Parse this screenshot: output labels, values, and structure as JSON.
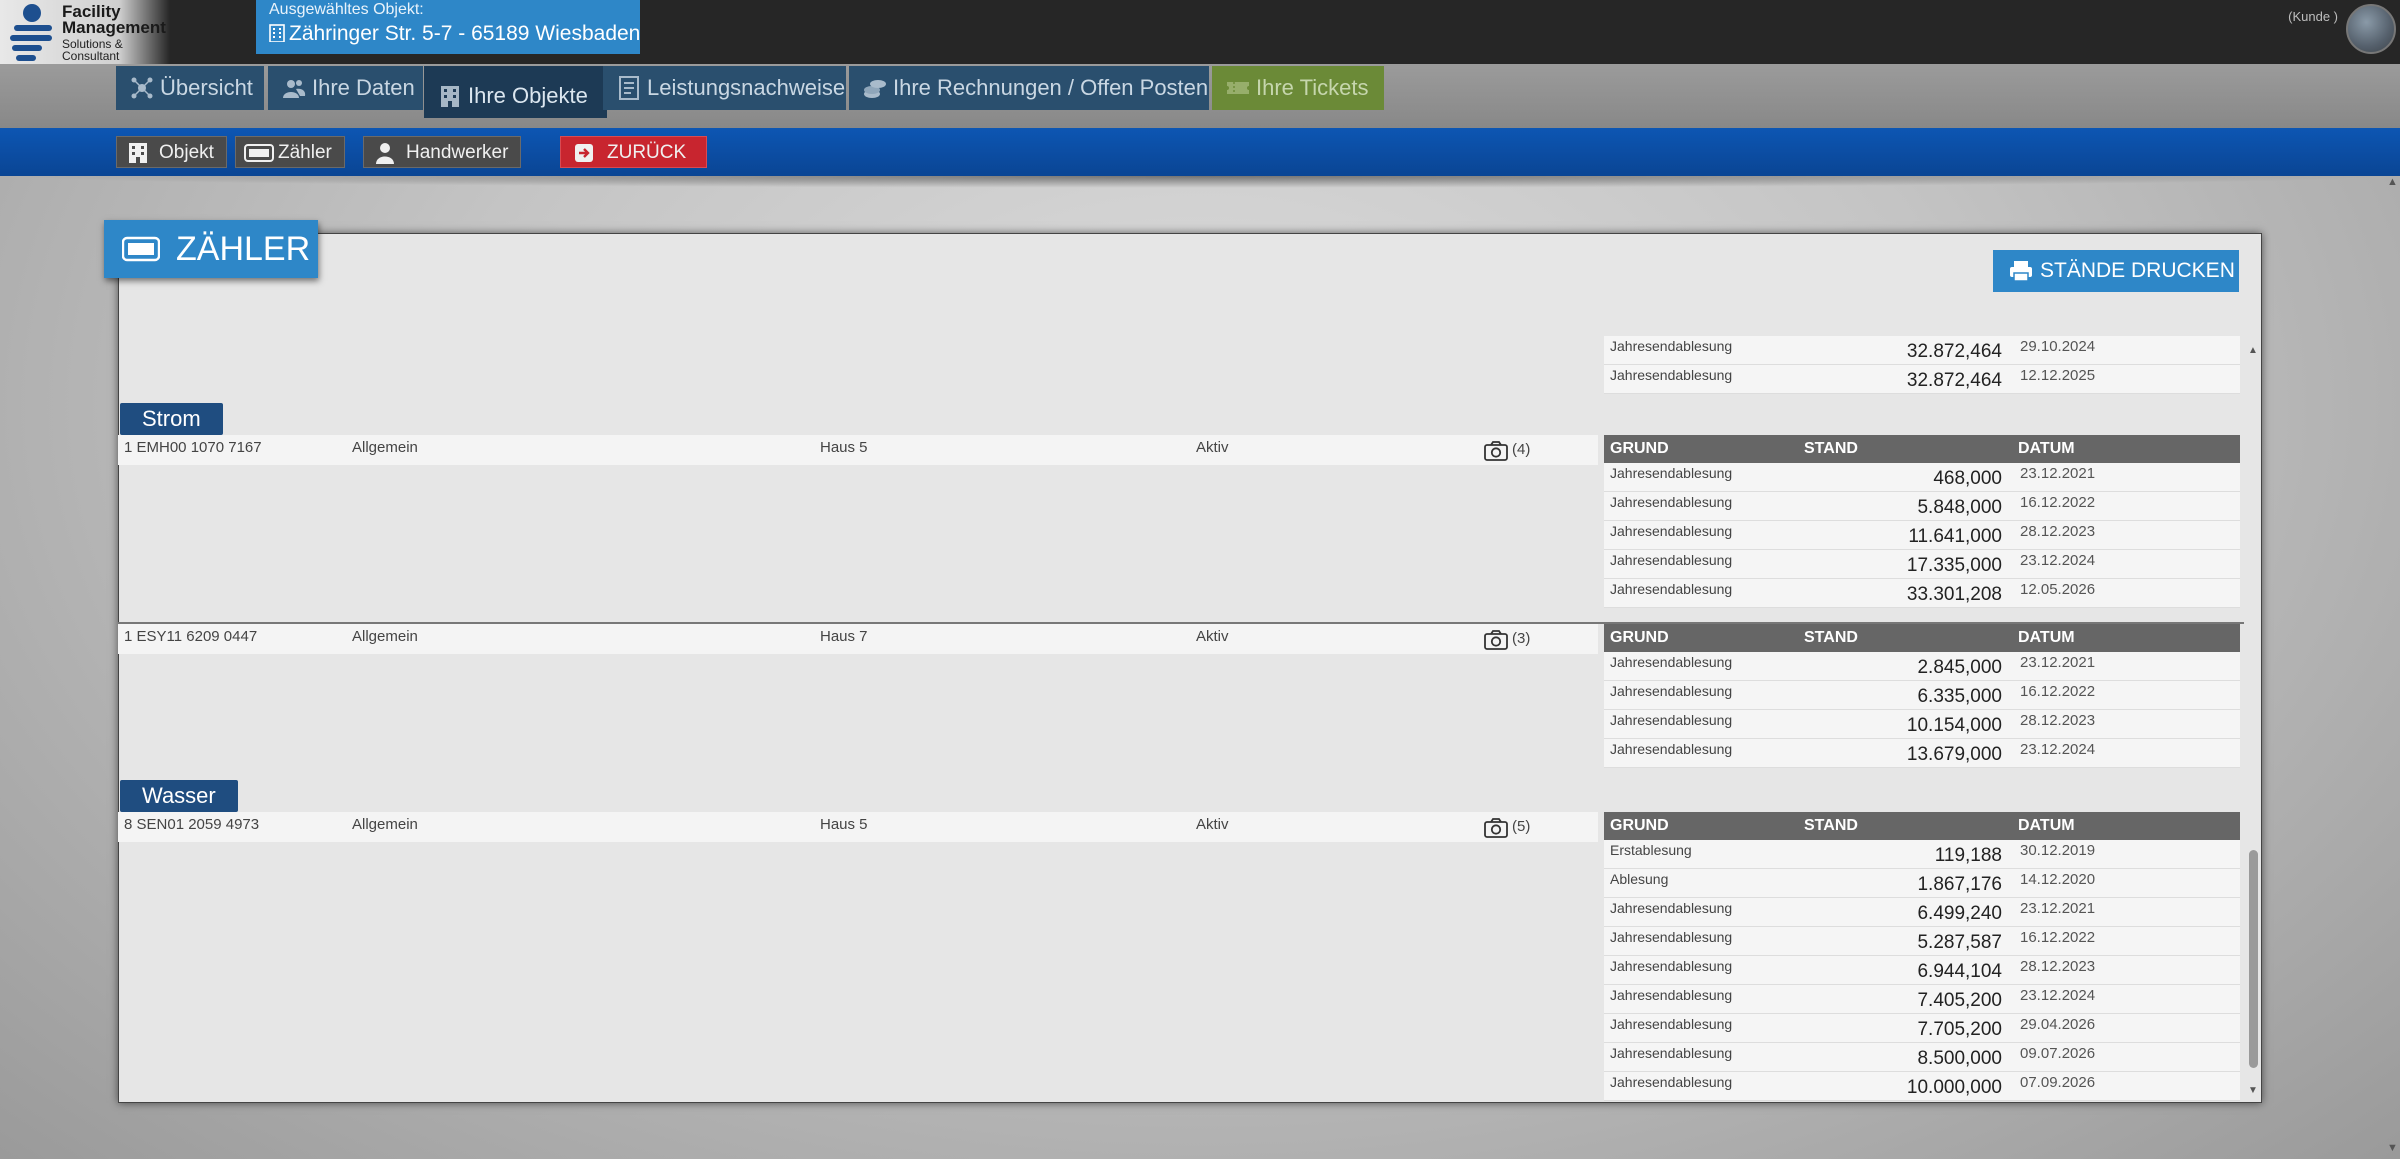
{
  "logo": {
    "line1": "Facility",
    "line2": "Management",
    "line3": "Solutions &",
    "line4": "Consultant"
  },
  "selected_object": {
    "label": "Ausgewähltes Objekt:",
    "value": "Zähringer Str. 5-7 - 65189 Wiesbaden",
    "icon": "building-icon"
  },
  "user": {
    "role": "(Kunde )"
  },
  "nav": {
    "tabs": [
      {
        "label": "Übersicht",
        "icon": "network-icon"
      },
      {
        "label": "Ihre Daten",
        "icon": "users-icon"
      },
      {
        "label": "Ihre Objekte",
        "icon": "building-icon",
        "active": true
      },
      {
        "label": "Leistungsnachweise",
        "icon": "document-icon"
      },
      {
        "label": "Ihre Rechnungen / Offen Posten",
        "icon": "coins-icon"
      },
      {
        "label": "Ihre Tickets",
        "icon": "ticket-icon"
      }
    ]
  },
  "subnav": {
    "objekt": "Objekt",
    "zaehler": "Zähler",
    "handwerker": "Handwerker",
    "back": "ZURÜCK"
  },
  "panel": {
    "title": "ZÄHLER",
    "print_button": "STÄNDE DRUCKEN"
  },
  "table_headers": {
    "grund": "GRUND",
    "stand": "STAND",
    "datum": "DATUM"
  },
  "partial_readings": [
    {
      "grund": "Jahresendablesung",
      "stand": "32.872,464",
      "datum": "29.10.2024"
    },
    {
      "grund": "Jahresendablesung",
      "stand": "32.872,464",
      "datum": "12.12.2025"
    }
  ],
  "categories": [
    {
      "name": "Strom",
      "meters": [
        {
          "number": "1 EMH00 1070 7167",
          "type": "Allgemein",
          "location": "Haus 5",
          "status": "Aktiv",
          "photos": "(4)",
          "readings": [
            {
              "grund": "Jahresendablesung",
              "stand": "468,000",
              "datum": "23.12.2021"
            },
            {
              "grund": "Jahresendablesung",
              "stand": "5.848,000",
              "datum": "16.12.2022"
            },
            {
              "grund": "Jahresendablesung",
              "stand": "11.641,000",
              "datum": "28.12.2023"
            },
            {
              "grund": "Jahresendablesung",
              "stand": "17.335,000",
              "datum": "23.12.2024"
            },
            {
              "grund": "Jahresendablesung",
              "stand": "33.301,208",
              "datum": "12.05.2026"
            }
          ]
        },
        {
          "number": "1 ESY11 6209 0447",
          "type": "Allgemein",
          "location": "Haus 7",
          "status": "Aktiv",
          "photos": "(3)",
          "readings": [
            {
              "grund": "Jahresendablesung",
              "stand": "2.845,000",
              "datum": "23.12.2021"
            },
            {
              "grund": "Jahresendablesung",
              "stand": "6.335,000",
              "datum": "16.12.2022"
            },
            {
              "grund": "Jahresendablesung",
              "stand": "10.154,000",
              "datum": "28.12.2023"
            },
            {
              "grund": "Jahresendablesung",
              "stand": "13.679,000",
              "datum": "23.12.2024"
            }
          ]
        }
      ]
    },
    {
      "name": "Wasser",
      "meters": [
        {
          "number": "8 SEN01 2059 4973",
          "type": "Allgemein",
          "location": "Haus 5",
          "status": "Aktiv",
          "photos": "(5)",
          "readings": [
            {
              "grund": "Erstablesung",
              "stand": "119,188",
              "datum": "30.12.2019"
            },
            {
              "grund": "Ablesung",
              "stand": "1.867,176",
              "datum": "14.12.2020"
            },
            {
              "grund": "Jahresendablesung",
              "stand": "6.499,240",
              "datum": "23.12.2021"
            },
            {
              "grund": "Jahresendablesung",
              "stand": "5.287,587",
              "datum": "16.12.2022"
            },
            {
              "grund": "Jahresendablesung",
              "stand": "6.944,104",
              "datum": "28.12.2023"
            },
            {
              "grund": "Jahresendablesung",
              "stand": "7.405,200",
              "datum": "23.12.2024"
            },
            {
              "grund": "Jahresendablesung",
              "stand": "7.705,200",
              "datum": "29.04.2026"
            },
            {
              "grund": "Jahresendablesung",
              "stand": "8.500,000",
              "datum": "09.07.2026"
            },
            {
              "grund": "Jahresendablesung",
              "stand": "10.000,000",
              "datum": "07.09.2026"
            }
          ]
        }
      ]
    }
  ],
  "colors": {
    "accent": "#2e87c8",
    "nav_tab": "#2a4f6e",
    "subbar": "#0d56b3",
    "back_button": "#c8252f",
    "tickets_tab": "#6b8a37",
    "category": "#1f4d80"
  }
}
